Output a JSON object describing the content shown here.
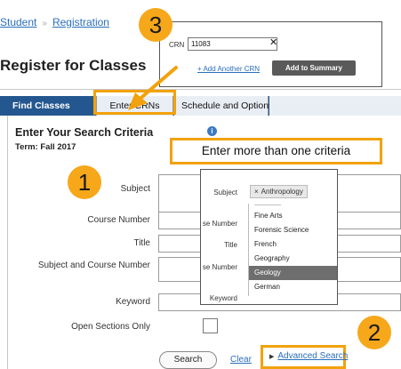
{
  "breadcrumb": {
    "item1": "Student",
    "item2": "Registration"
  },
  "page": {
    "title": "Register for Classes"
  },
  "tabs": [
    {
      "label": "Find Classes"
    },
    {
      "label": "Enter CRNs"
    },
    {
      "label": "Schedule and Options"
    }
  ],
  "search": {
    "heading": "Enter Your Search Criteria",
    "term": "Term: Fall 2017",
    "labels": {
      "subject": "Subject",
      "course_number": "Course Number",
      "title": "Title",
      "subject_course": "Subject and Course Number",
      "keyword": "Keyword",
      "open_sections": "Open Sections Only"
    },
    "search_button": "Search",
    "clear_link": "Clear",
    "advanced_link": "Advanced Search"
  },
  "crn_popup": {
    "label": "CRN",
    "value": "11083",
    "clear_glyph": "✕",
    "add_another": "+ Add Another CRN",
    "add_to_summary": "Add to Summary"
  },
  "tip": {
    "text": "Enter more than one criteria"
  },
  "dropdown": {
    "labels": {
      "subject": "Subject",
      "course": "se Number",
      "title": "Title",
      "subcourse": "se Number",
      "keyword": "Keyword"
    },
    "selected_chip": "Anthropology",
    "options": [
      "Fine Arts",
      "Forensic Science",
      "French",
      "Geography",
      "Geology",
      "German"
    ],
    "highlighted_option": "Geology"
  },
  "callouts": [
    "1",
    "2",
    "3"
  ],
  "colors": {
    "accent": "#f2a20c",
    "tab_bar": "#24578f",
    "link": "#2a6ebb"
  },
  "icons": {
    "info": "info-icon",
    "clear": "close-icon",
    "arrow": "arrow-icon"
  }
}
